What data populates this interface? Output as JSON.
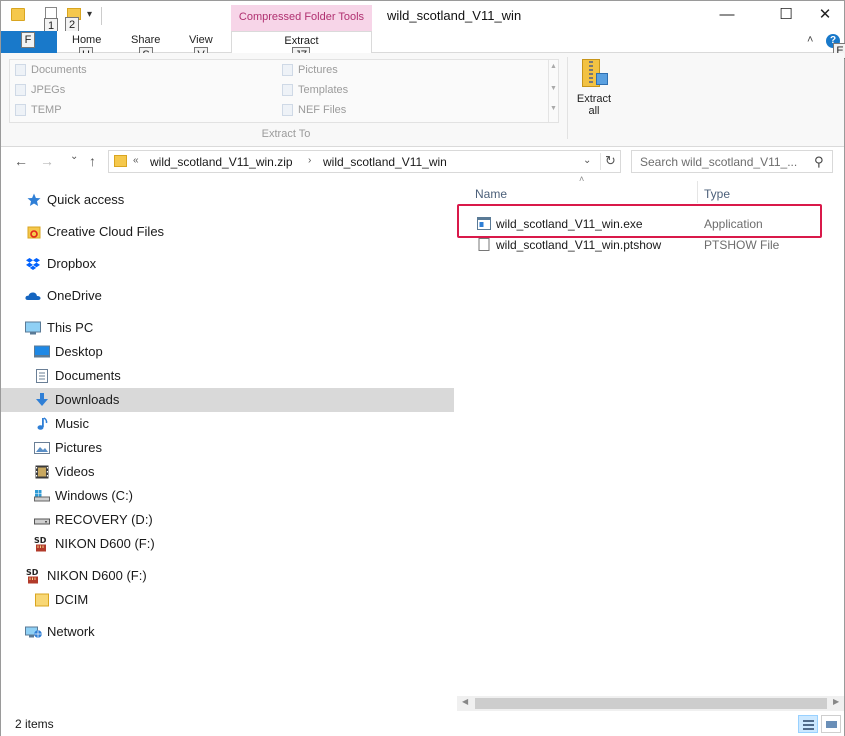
{
  "window": {
    "title": "wild_scotland_V11_win",
    "contextual_tab_group": "Compressed Folder Tools",
    "minimize": "—",
    "maximize": "☐",
    "close": "✕"
  },
  "quick_access_toolbar": {
    "keytips": [
      "1",
      "2"
    ],
    "customize_arrow": "▾"
  },
  "ribbon": {
    "tabs": [
      {
        "label": "Home",
        "keytip": "H"
      },
      {
        "label": "Share",
        "keytip": "S"
      },
      {
        "label": "View",
        "keytip": "V"
      },
      {
        "label": "Extract",
        "keytip": "JZ"
      }
    ],
    "file_keytip": "F",
    "help_keytip": "E",
    "collapse_glyph": "˄",
    "help_glyph": "?",
    "extract_to": {
      "group_label": "Extract To",
      "destinations_col1": [
        "Documents",
        "JPEGs",
        "TEMP"
      ],
      "destinations_col2": [
        "Pictures",
        "Templates",
        "NEF Files"
      ]
    },
    "extract_all": {
      "line1": "Extract",
      "line2": "all"
    }
  },
  "navigation": {
    "back": "←",
    "forward": "→",
    "recent": "⌄",
    "up": "↑",
    "address": {
      "overflow": "«",
      "segments": [
        "wild_scotland_V11_win.zip",
        "wild_scotland_V11_win"
      ],
      "separator": "›",
      "dropdown": "⌄",
      "refresh": "↻"
    },
    "search_placeholder": "Search wild_scotland_V11_...",
    "search_glyph": "⚲"
  },
  "nav_pane": {
    "items": [
      {
        "label": "Quick access",
        "icon": "star-icon"
      },
      {
        "label": "Creative Cloud Files",
        "icon": "creative-cloud-icon"
      },
      {
        "label": "Dropbox",
        "icon": "dropbox-icon"
      },
      {
        "label": "OneDrive",
        "icon": "onedrive-icon"
      },
      {
        "label": "This PC",
        "icon": "computer-icon"
      },
      {
        "label": "Desktop",
        "icon": "desktop-icon"
      },
      {
        "label": "Documents",
        "icon": "documents-icon"
      },
      {
        "label": "Downloads",
        "icon": "downloads-icon",
        "selected": true
      },
      {
        "label": "Music",
        "icon": "music-icon"
      },
      {
        "label": "Pictures",
        "icon": "pictures-icon"
      },
      {
        "label": "Videos",
        "icon": "videos-icon"
      },
      {
        "label": "Windows (C:)",
        "icon": "windows-drive-icon"
      },
      {
        "label": "RECOVERY (D:)",
        "icon": "drive-icon"
      },
      {
        "label": "NIKON D600 (F:)",
        "icon": "sd-card-icon"
      },
      {
        "label": "NIKON D600 (F:)",
        "icon": "sd-card-icon"
      },
      {
        "label": "DCIM",
        "icon": "folder-icon"
      },
      {
        "label": "Network",
        "icon": "network-icon"
      }
    ],
    "sd_label": "SD"
  },
  "file_list": {
    "columns": [
      "Name",
      "Type"
    ],
    "sort_glyph": "˄",
    "files": [
      {
        "name": "wild_scotland_V11_win.exe",
        "type": "Application",
        "icon": "application-icon"
      },
      {
        "name": "wild_scotland_V11_win.ptshow",
        "type": "PTSHOW File",
        "icon": "file-icon"
      }
    ]
  },
  "status_bar": {
    "item_count": "2 items"
  },
  "colors": {
    "file_tab": "#1979ca",
    "context_tab": "#f7d5e8",
    "selection": "#d9d9d9",
    "highlight_box": "#d9194a"
  }
}
